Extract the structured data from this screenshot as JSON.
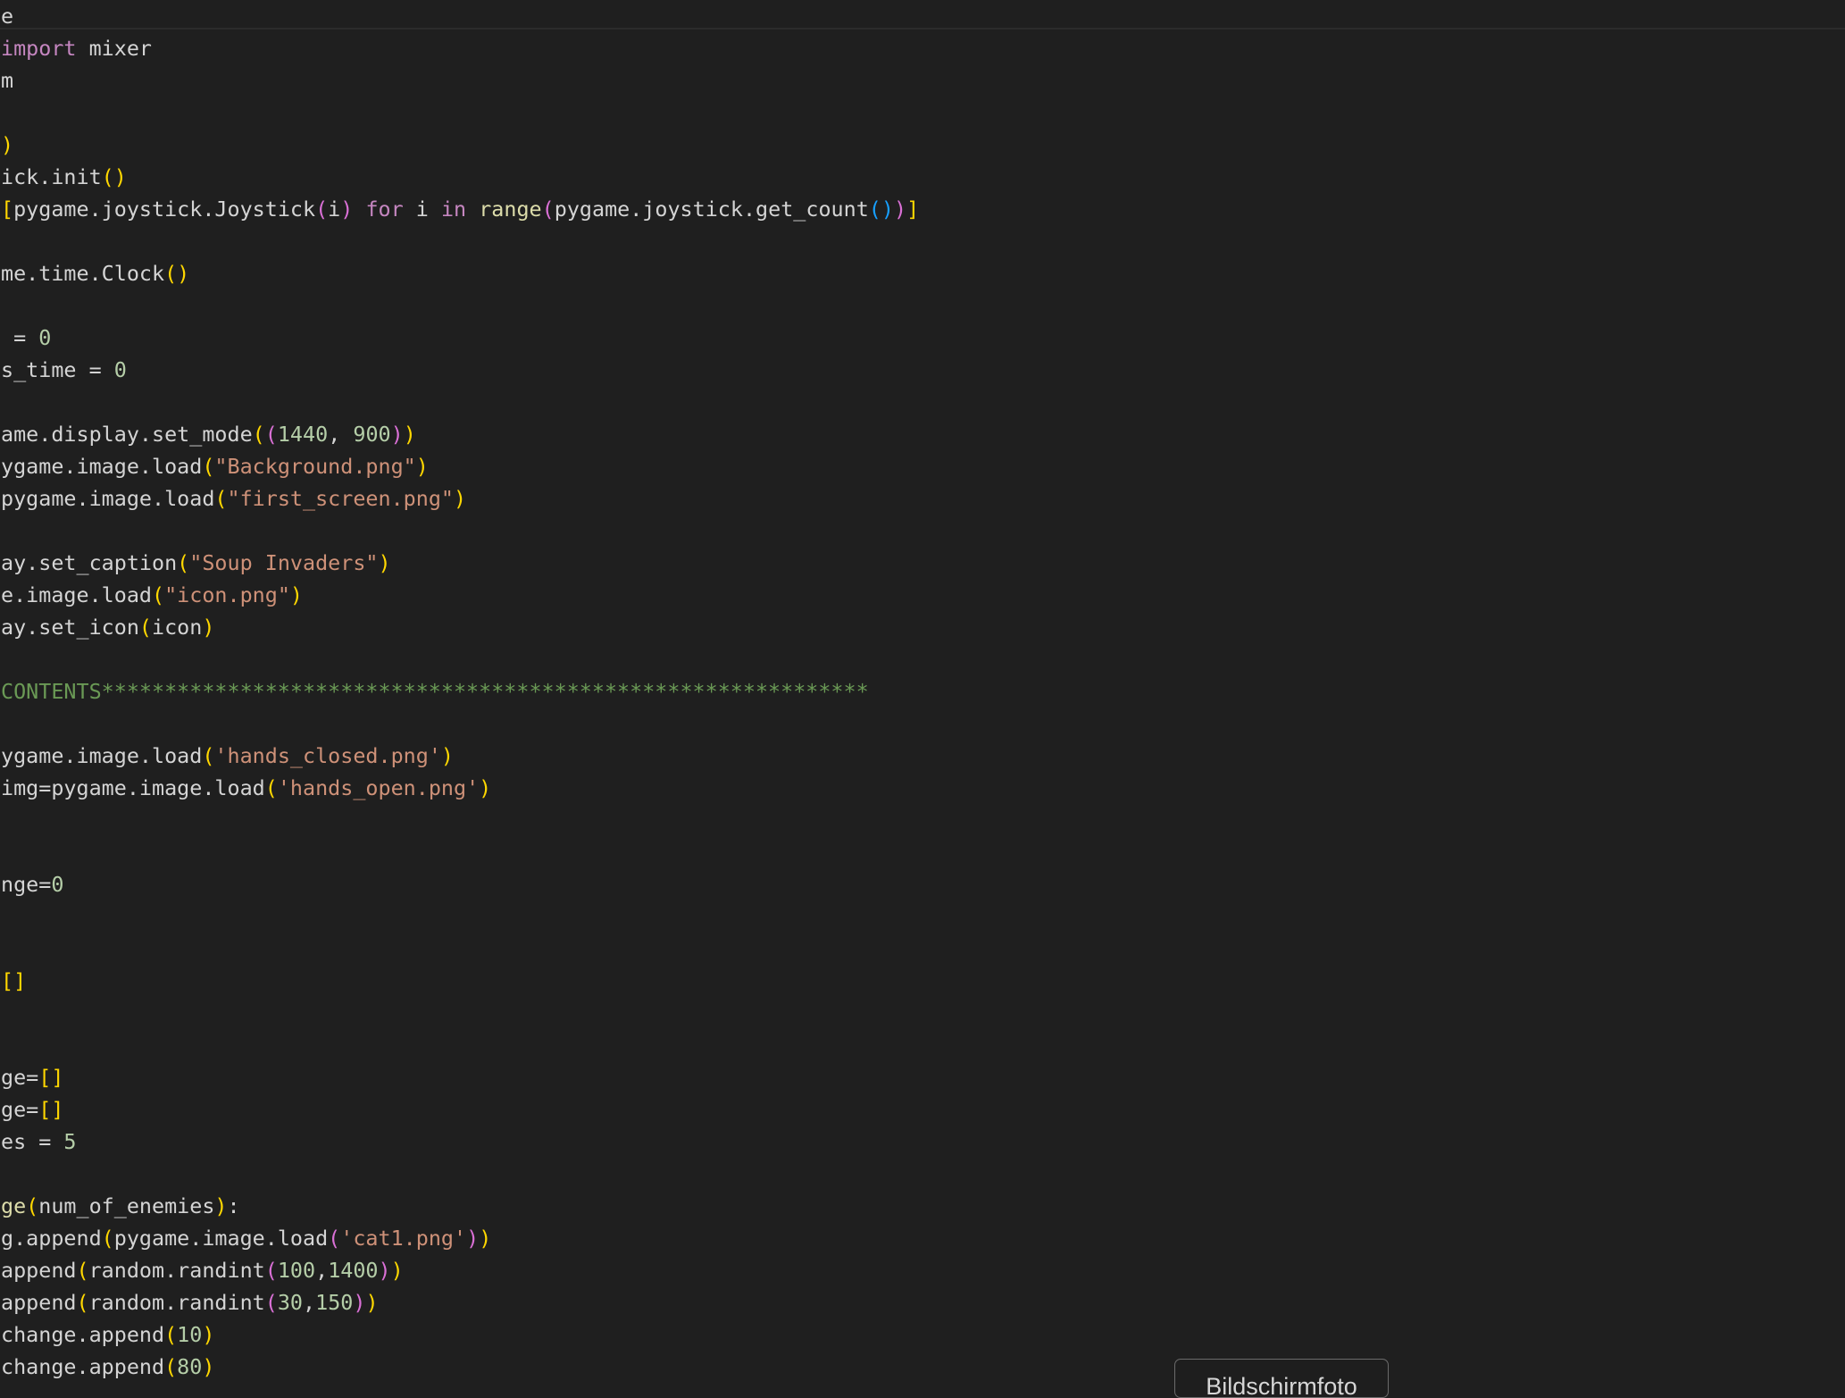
{
  "editor": {
    "theme": {
      "background": "#1f1f1f",
      "default_text": "#d4d4d4",
      "keyword": "#c586c0",
      "function": "#dcdcaa",
      "string": "#ce9178",
      "number": "#b5cea8",
      "comment": "#6a9955",
      "bracket_level_1": "#ffd700",
      "bracket_level_2": "#da70d6",
      "bracket_level_3": "#179fff"
    },
    "lines": [
      [
        {
          "t": "e",
          "c": "txt"
        }
      ],
      [
        {
          "t": "import",
          "c": "kw"
        },
        {
          "t": " mixer",
          "c": "txt"
        }
      ],
      [
        {
          "t": "m",
          "c": "txt"
        }
      ],
      [],
      [
        {
          "t": ")",
          "c": "b1"
        }
      ],
      [
        {
          "t": "ick.init",
          "c": "txt"
        },
        {
          "t": "()",
          "c": "b1"
        }
      ],
      [
        {
          "t": "[",
          "c": "b1"
        },
        {
          "t": "pygame.joystick.Joystick",
          "c": "txt"
        },
        {
          "t": "(",
          "c": "b2"
        },
        {
          "t": "i",
          "c": "txt"
        },
        {
          "t": ")",
          "c": "b2"
        },
        {
          "t": " ",
          "c": "txt"
        },
        {
          "t": "for",
          "c": "kw"
        },
        {
          "t": " i ",
          "c": "txt"
        },
        {
          "t": "in",
          "c": "kw"
        },
        {
          "t": " ",
          "c": "txt"
        },
        {
          "t": "range",
          "c": "fn"
        },
        {
          "t": "(",
          "c": "b2"
        },
        {
          "t": "pygame.joystick.get_count",
          "c": "txt"
        },
        {
          "t": "()",
          "c": "b3"
        },
        {
          "t": ")",
          "c": "b2"
        },
        {
          "t": "]",
          "c": "b1"
        }
      ],
      [],
      [
        {
          "t": "me.time.Clock",
          "c": "txt"
        },
        {
          "t": "()",
          "c": "b1"
        }
      ],
      [],
      [
        {
          "t": " = ",
          "c": "txt"
        },
        {
          "t": "0",
          "c": "num"
        }
      ],
      [
        {
          "t": "s_time = ",
          "c": "txt"
        },
        {
          "t": "0",
          "c": "num"
        }
      ],
      [],
      [
        {
          "t": "ame.display.set_mode",
          "c": "txt"
        },
        {
          "t": "(",
          "c": "b1"
        },
        {
          "t": "(",
          "c": "b2"
        },
        {
          "t": "1440",
          "c": "num"
        },
        {
          "t": ", ",
          "c": "txt"
        },
        {
          "t": "900",
          "c": "num"
        },
        {
          "t": ")",
          "c": "b2"
        },
        {
          "t": ")",
          "c": "b1"
        }
      ],
      [
        {
          "t": "ygame.image.load",
          "c": "txt"
        },
        {
          "t": "(",
          "c": "b1"
        },
        {
          "t": "\"Background.png\"",
          "c": "str"
        },
        {
          "t": ")",
          "c": "b1"
        }
      ],
      [
        {
          "t": "pygame.image.load",
          "c": "txt"
        },
        {
          "t": "(",
          "c": "b1"
        },
        {
          "t": "\"first_screen.png\"",
          "c": "str"
        },
        {
          "t": ")",
          "c": "b1"
        }
      ],
      [],
      [
        {
          "t": "ay.set_caption",
          "c": "txt"
        },
        {
          "t": "(",
          "c": "b1"
        },
        {
          "t": "\"Soup Invaders\"",
          "c": "str"
        },
        {
          "t": ")",
          "c": "b1"
        }
      ],
      [
        {
          "t": "e.image.load",
          "c": "txt"
        },
        {
          "t": "(",
          "c": "b1"
        },
        {
          "t": "\"icon.png\"",
          "c": "str"
        },
        {
          "t": ")",
          "c": "b1"
        }
      ],
      [
        {
          "t": "ay.set_icon",
          "c": "txt"
        },
        {
          "t": "(",
          "c": "b1"
        },
        {
          "t": "icon",
          "c": "txt"
        },
        {
          "t": ")",
          "c": "b1"
        }
      ],
      [],
      [
        {
          "t": "CONTENTS*************************************************************",
          "c": "cmt"
        }
      ],
      [],
      [
        {
          "t": "ygame.image.load",
          "c": "txt"
        },
        {
          "t": "(",
          "c": "b1"
        },
        {
          "t": "'hands_closed.png'",
          "c": "str"
        },
        {
          "t": ")",
          "c": "b1"
        }
      ],
      [
        {
          "t": "img=pygame.image.load",
          "c": "txt"
        },
        {
          "t": "(",
          "c": "b1"
        },
        {
          "t": "'hands_open.png'",
          "c": "str"
        },
        {
          "t": ")",
          "c": "b1"
        }
      ],
      [],
      [],
      [
        {
          "t": "nge=",
          "c": "txt"
        },
        {
          "t": "0",
          "c": "num"
        }
      ],
      [],
      [],
      [
        {
          "t": "[]",
          "c": "b1"
        }
      ],
      [],
      [],
      [
        {
          "t": "ge=",
          "c": "txt"
        },
        {
          "t": "[]",
          "c": "b1"
        }
      ],
      [
        {
          "t": "ge=",
          "c": "txt"
        },
        {
          "t": "[]",
          "c": "b1"
        }
      ],
      [
        {
          "t": "es = ",
          "c": "txt"
        },
        {
          "t": "5",
          "c": "num"
        }
      ],
      [],
      [
        {
          "t": "ge",
          "c": "fn"
        },
        {
          "t": "(",
          "c": "b1"
        },
        {
          "t": "num_of_enemies",
          "c": "txt"
        },
        {
          "t": ")",
          "c": "b1"
        },
        {
          "t": ":",
          "c": "txt"
        }
      ],
      [
        {
          "t": "g.append",
          "c": "txt"
        },
        {
          "t": "(",
          "c": "b1"
        },
        {
          "t": "pygame.image.load",
          "c": "txt"
        },
        {
          "t": "(",
          "c": "b2"
        },
        {
          "t": "'cat1.png'",
          "c": "str"
        },
        {
          "t": ")",
          "c": "b2"
        },
        {
          "t": ")",
          "c": "b1"
        }
      ],
      [
        {
          "t": "append",
          "c": "txt"
        },
        {
          "t": "(",
          "c": "b1"
        },
        {
          "t": "random.randint",
          "c": "txt"
        },
        {
          "t": "(",
          "c": "b2"
        },
        {
          "t": "100",
          "c": "num"
        },
        {
          "t": ",",
          "c": "txt"
        },
        {
          "t": "1400",
          "c": "num"
        },
        {
          "t": ")",
          "c": "b2"
        },
        {
          "t": ")",
          "c": "b1"
        }
      ],
      [
        {
          "t": "append",
          "c": "txt"
        },
        {
          "t": "(",
          "c": "b1"
        },
        {
          "t": "random.randint",
          "c": "txt"
        },
        {
          "t": "(",
          "c": "b2"
        },
        {
          "t": "30",
          "c": "num"
        },
        {
          "t": ",",
          "c": "txt"
        },
        {
          "t": "150",
          "c": "num"
        },
        {
          "t": ")",
          "c": "b2"
        },
        {
          "t": ")",
          "c": "b1"
        }
      ],
      [
        {
          "t": "change.append",
          "c": "txt"
        },
        {
          "t": "(",
          "c": "b1"
        },
        {
          "t": "10",
          "c": "num"
        },
        {
          "t": ")",
          "c": "b1"
        }
      ],
      [
        {
          "t": "change.append",
          "c": "txt"
        },
        {
          "t": "(",
          "c": "b1"
        },
        {
          "t": "80",
          "c": "num"
        },
        {
          "t": ")",
          "c": "b1"
        }
      ]
    ]
  },
  "tooltip": {
    "label": "Bildschirmfoto"
  }
}
